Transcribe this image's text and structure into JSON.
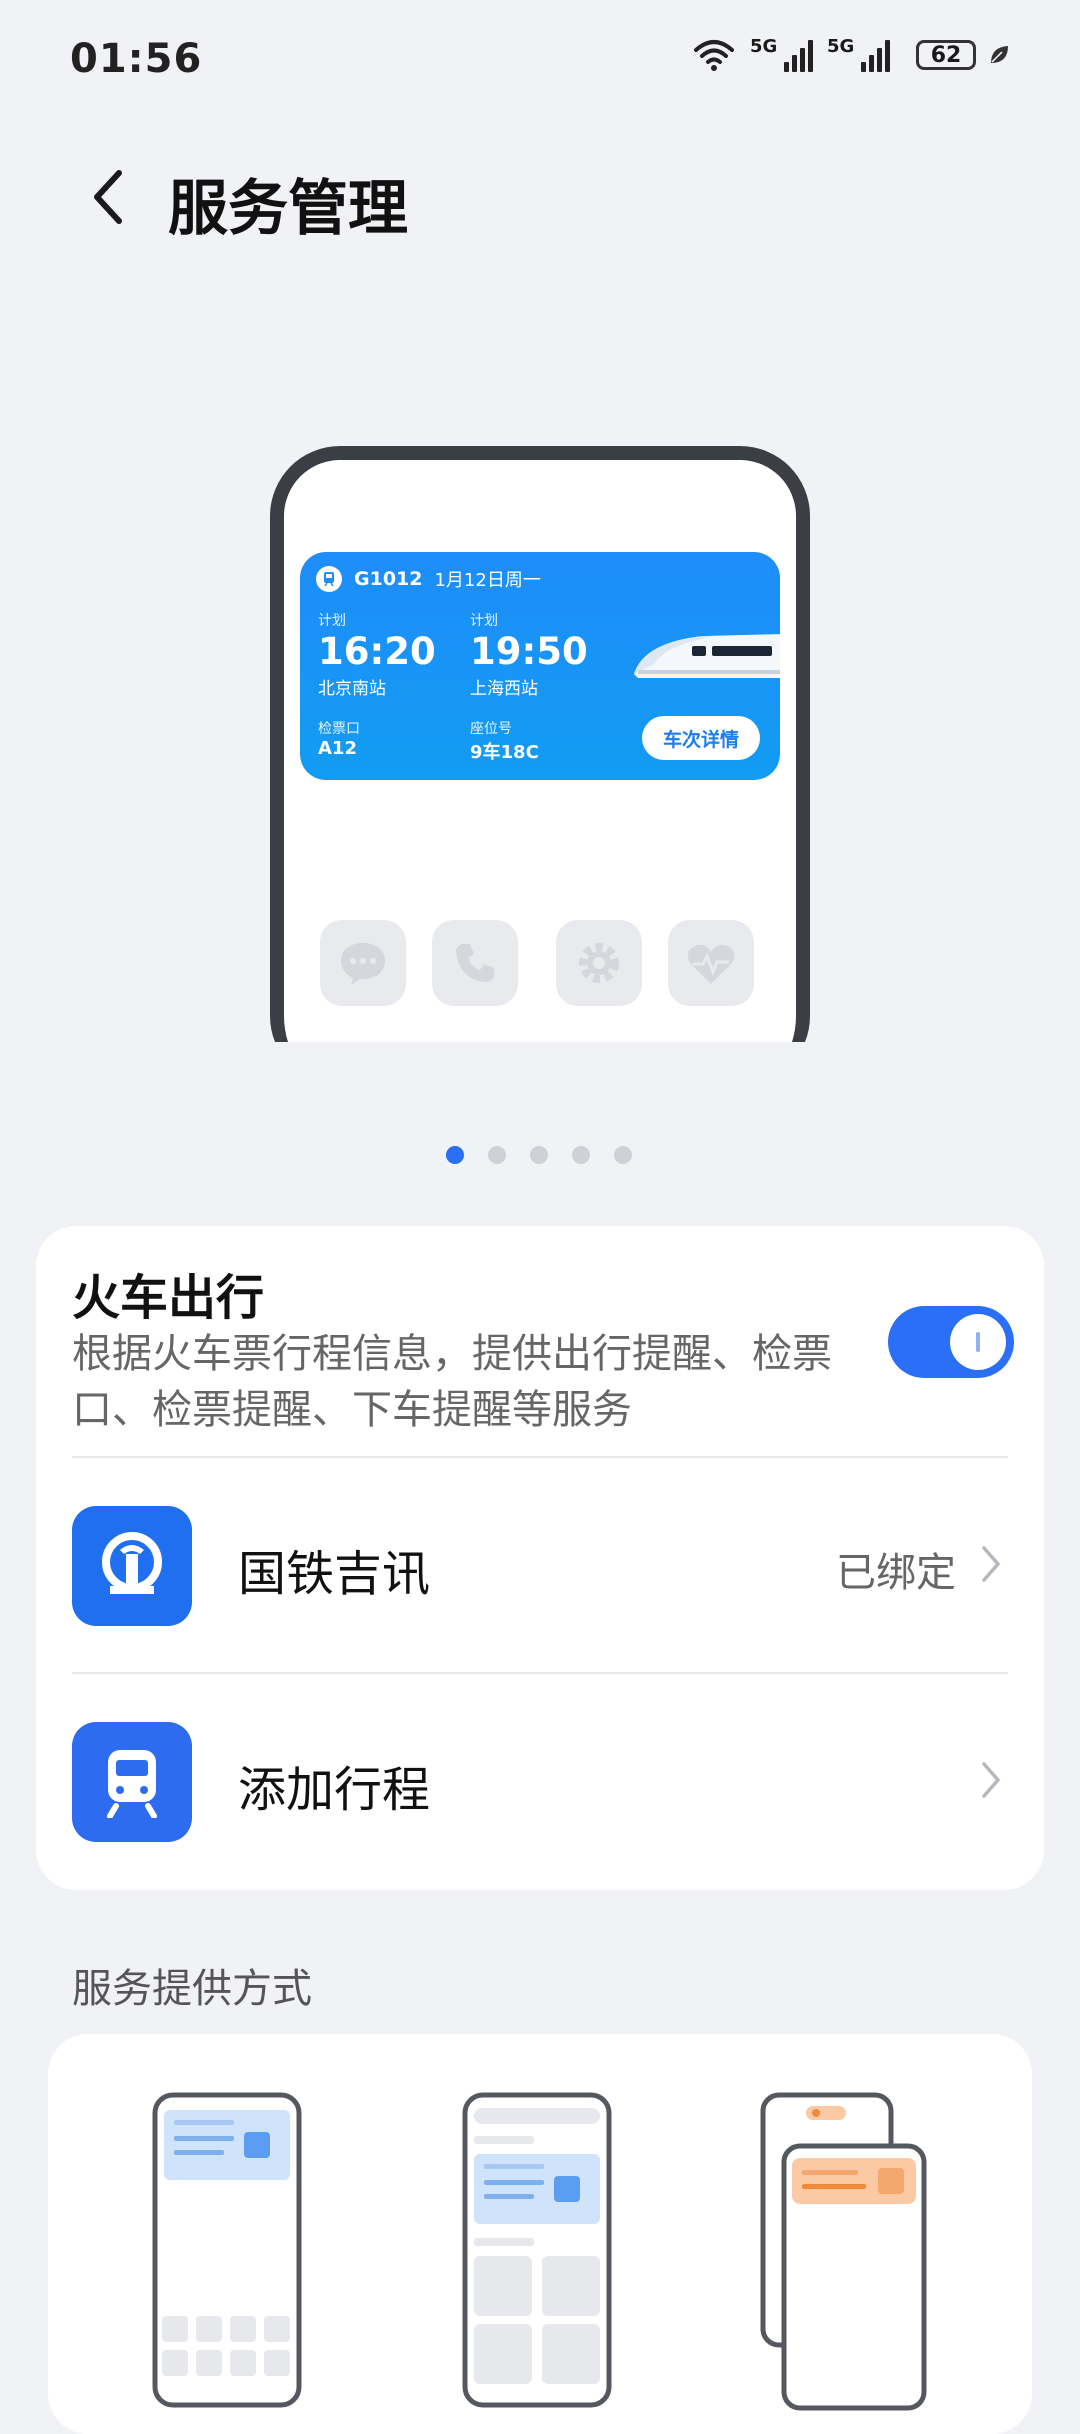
{
  "status_bar": {
    "time": "01:56",
    "battery": "62",
    "net1": "5G",
    "net2": "5G",
    "icons": [
      "wifi-icon",
      "signal-icon",
      "signal-icon",
      "battery-icon",
      "leaf-icon"
    ]
  },
  "header": {
    "title": "服务管理",
    "back_icon": "chevron-left-icon"
  },
  "preview": {
    "widget": {
      "train_no": "G1012",
      "date": "1月12日周一",
      "dep_label": "计划",
      "dep_time": "16:20",
      "dep_station": "北京南站",
      "arr_label": "计划",
      "arr_time": "19:50",
      "arr_station": "上海西站",
      "gate_label": "检票口",
      "gate": "A12",
      "seat_label": "座位号",
      "seat": "9车18C",
      "detail_button": "车次详情"
    },
    "dock_icons": [
      "message-icon",
      "phone-icon",
      "settings-icon",
      "health-icon"
    ]
  },
  "pager": {
    "count": 5,
    "active": 0
  },
  "service_card": {
    "title": "火车出行",
    "description": "根据火车票行程信息，提供出行提醒、检票口、检票提醒、下车提醒等服务",
    "enabled": true,
    "rows": [
      {
        "icon": "railway-logo-icon",
        "label": "国铁吉讯",
        "value": "已绑定"
      },
      {
        "icon": "train-icon",
        "label": "添加行程",
        "value": ""
      }
    ]
  },
  "provision": {
    "title": "服务提供方式",
    "options": [
      "widget-lockscreen-illustration",
      "widget-minus-one-screen-illustration",
      "notification-illustration"
    ]
  },
  "colors": {
    "accent": "#2b6ff6",
    "widget_blue": "#1e8dfa",
    "background": "#f1f2f5"
  }
}
